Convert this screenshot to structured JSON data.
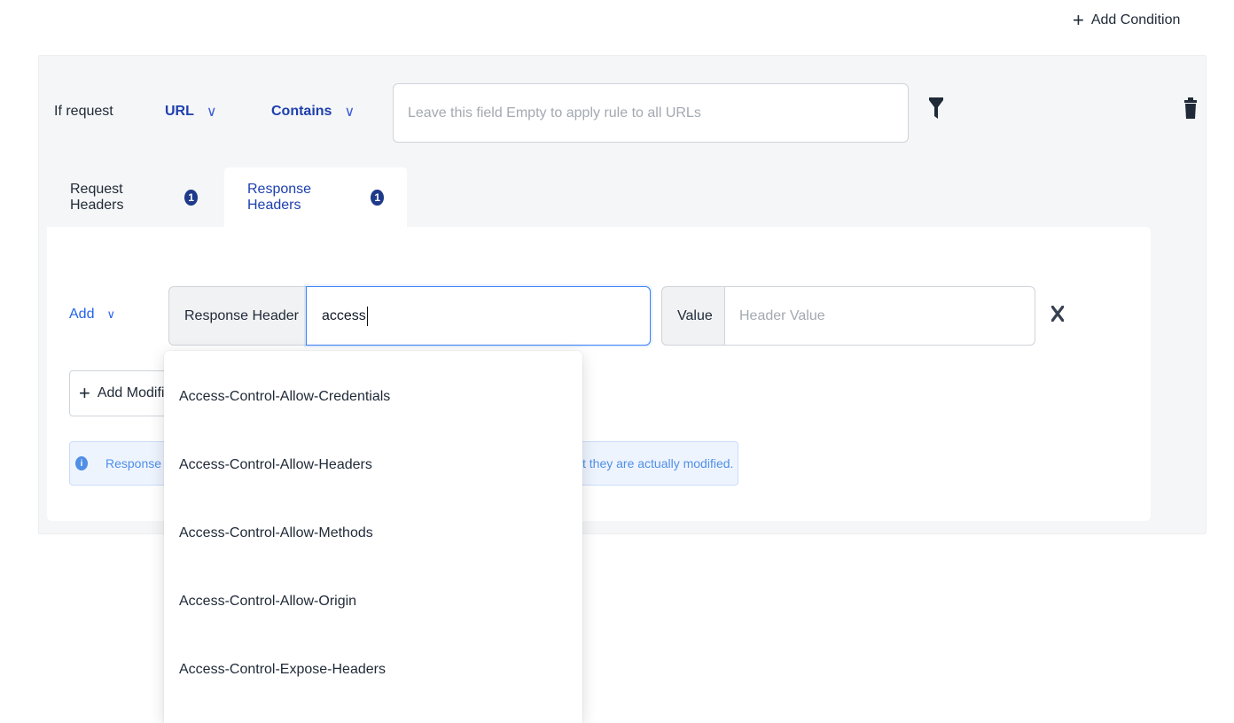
{
  "header": {
    "add_condition_label": "Add Condition"
  },
  "condition": {
    "prefix_label": "If request",
    "source_type": "URL",
    "operator": "Contains",
    "url_placeholder": "Leave this field Empty to apply rule to all URLs"
  },
  "tabs": [
    {
      "label": "Request Headers",
      "count": "1"
    },
    {
      "label": "Response Headers",
      "count": "1"
    }
  ],
  "modification": {
    "action": "Add",
    "header_addon": "Response Header",
    "header_value": "access",
    "value_addon": "Value",
    "value_placeholder": "Header Value"
  },
  "add_modification_label": "Add Modific",
  "info": {
    "text_start": "Response",
    "text_end": "t they are actually modified."
  },
  "suggestions": [
    "Access-Control-Allow-Credentials",
    "Access-Control-Allow-Headers",
    "Access-Control-Allow-Methods",
    "Access-Control-Allow-Origin",
    "Access-Control-Expose-Headers"
  ],
  "colors": {
    "accent": "#1e40af",
    "link": "#2563eb",
    "info": "#4f8fe6"
  },
  "icons": [
    "plus-icon",
    "chevron-down-icon",
    "filter-icon",
    "trash-icon",
    "close-icon",
    "info-icon"
  ]
}
